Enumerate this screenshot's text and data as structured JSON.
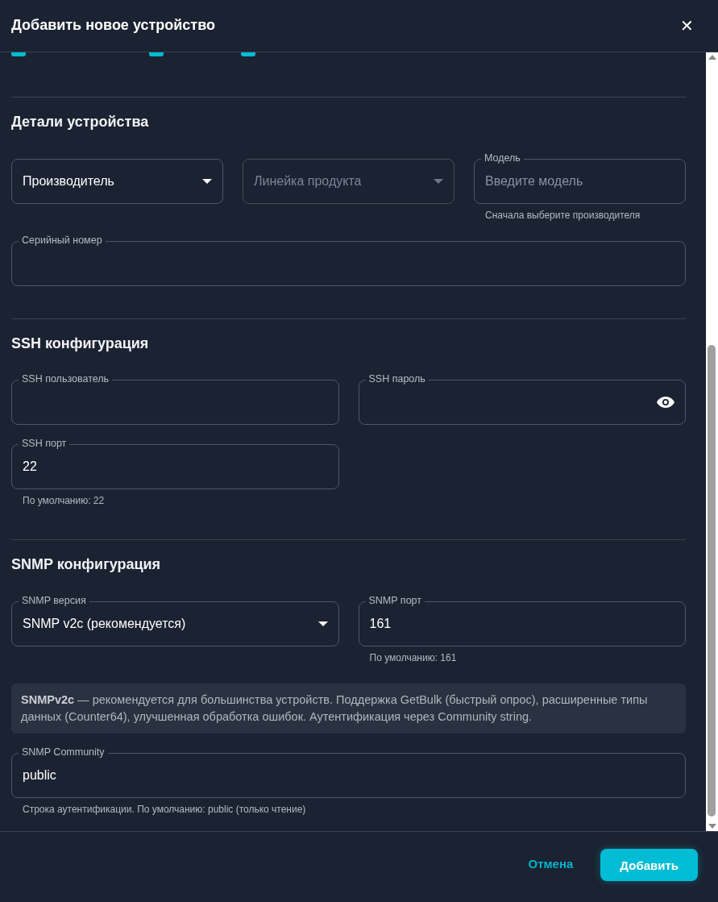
{
  "dialog": {
    "title": "Добавить новое устройство",
    "close": "✕"
  },
  "checkboxes": [
    {
      "checked": true
    },
    {
      "checked": true
    },
    {
      "checked": true
    }
  ],
  "sections": [
    {
      "title": "Детали устройства",
      "rows": [
        [
          {
            "kind": "select",
            "label": "Производитель",
            "disabled": false
          },
          {
            "kind": "select",
            "label": "Линейка продукта",
            "disabled": true
          },
          {
            "kind": "text",
            "label": "Модель",
            "placeholder": "Введите модель",
            "helper": "Сначала выберите производителя"
          }
        ],
        [
          {
            "kind": "text",
            "label": "Серийный номер"
          }
        ]
      ]
    },
    {
      "title": "SSH конфигурация",
      "rows": [
        [
          {
            "kind": "text",
            "label": "SSH пользователь"
          },
          {
            "kind": "password",
            "label": "SSH пароль"
          }
        ],
        [
          {
            "kind": "text",
            "label": "SSH порт",
            "value": "22",
            "helper": "По умолчанию: 22"
          }
        ]
      ]
    },
    {
      "title": "SNMP конфигурация",
      "rows": [
        [
          {
            "kind": "select",
            "label": "SNMP версия",
            "value": "SNMP v2c (рекомендуется)",
            "disabled": false
          },
          {
            "kind": "text",
            "label": "SNMP порт",
            "value": "161",
            "helper": "По умолчанию: 161"
          }
        ],
        [
          {
            "kind": "info",
            "text": "**SNMPv2c** — рекомендуется для большинства устройств. Поддержка GetBulk (быстрый опрос), расширенные типы данных (Counter64), улучшенная обработка ошибок. Аутентификация через Community string."
          }
        ],
        [
          {
            "kind": "text",
            "label": "SNMP Community",
            "value": "public",
            "helper": "Строка аутентификации. По умолчанию: public (только чтение)"
          }
        ]
      ]
    }
  ],
  "buttons": [
    {
      "label": "Отмена",
      "kind": "text"
    },
    {
      "label": "Добавить",
      "kind": "primary"
    }
  ]
}
